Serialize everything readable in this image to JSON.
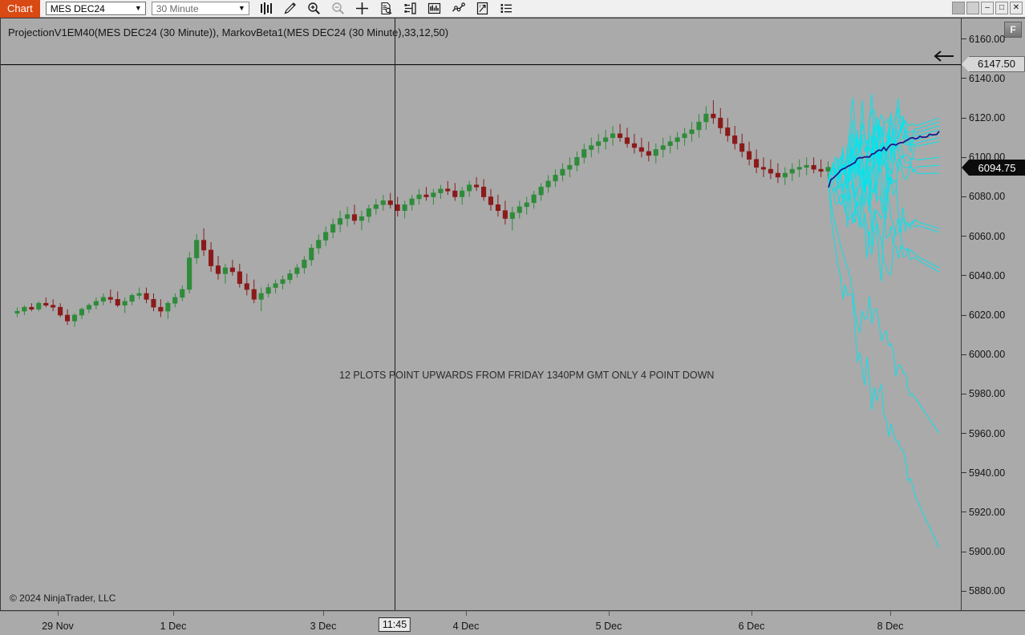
{
  "window": {
    "tab_label": "Chart",
    "controls": {
      "restore_down_label": "",
      "minimize_label": "–",
      "maximize_label": "□",
      "close_label": "✕"
    }
  },
  "toolbar": {
    "instrument": {
      "value": "MES DEC24",
      "arrow": "▼"
    },
    "interval": {
      "value": "30 Minute",
      "arrow": "▼"
    },
    "icons": [
      {
        "name": "bar-chart-type-icon",
        "enabled": true
      },
      {
        "name": "drawing-tools-pencil-icon",
        "enabled": true
      },
      {
        "name": "zoom-in-icon",
        "enabled": true
      },
      {
        "name": "zoom-out-icon",
        "enabled": false
      },
      {
        "name": "crosshair-icon",
        "enabled": true
      },
      {
        "name": "data-box-icon",
        "enabled": true
      },
      {
        "name": "chart-properties-icon",
        "enabled": true
      },
      {
        "name": "indicators-icon",
        "enabled": true
      },
      {
        "name": "strategies-icon",
        "enabled": true
      },
      {
        "name": "export-chart-icon",
        "enabled": true
      },
      {
        "name": "data-series-list-icon",
        "enabled": true
      }
    ]
  },
  "chart": {
    "title": "ProjectionV1EM40(MES DEC24 (30 Minute)), MarkovBeta1(MES DEC24 (30 Minute),33,12,50)",
    "annotation": "12 PLOTS POINT UPWARDS FROM FRIDAY 1340PM GMT ONLY 4 POINT DOWN",
    "copyright": "© 2024 NinjaTrader, LLC",
    "back_arrow_icon": "left-arrow-icon",
    "auto_scale_badge": "F",
    "crosshair_time": "11:45"
  },
  "price_axis": {
    "ticks": [
      "6160.00",
      "6140.00",
      "6120.00",
      "6100.00",
      "6080.00",
      "6060.00",
      "6040.00",
      "6020.00",
      "6000.00",
      "5980.00",
      "5960.00",
      "5940.00",
      "5920.00",
      "5900.00",
      "5880.00"
    ],
    "last_price_marker": "6147.50",
    "current_price_marker": "6094.75"
  },
  "time_axis": {
    "ticks": [
      "29 Nov",
      "1 Dec",
      "3 Dec",
      "4 Dec",
      "5 Dec",
      "6 Dec",
      "8 Dec"
    ]
  },
  "colors": {
    "tab_accent": "#d94913",
    "chart_background": "#aaaaaa",
    "candle_up": "#2e8b3a",
    "candle_down": "#8b1a1a",
    "projection_line": "#00e5ee",
    "average_line": "#1a1a8c",
    "current_price_bg": "#0b0b0b",
    "last_price_bg": "#d7d7d7"
  },
  "chart_data": {
    "type": "line",
    "title": "ProjectionV1EM40(MES DEC24 (30 Minute)), MarkovBeta1(MES DEC24 (30 Minute),33,12,50)",
    "xlabel": "",
    "ylabel": "",
    "ylim": [
      5870,
      6170
    ],
    "grid": false,
    "legend": "none",
    "x_tick_labels": [
      "29 Nov",
      "1 Dec",
      "3 Dec",
      "4 Dec",
      "5 Dec",
      "6 Dec",
      "8 Dec"
    ],
    "y_tick_labels": [
      "6160.00",
      "6140.00",
      "6120.00",
      "6100.00",
      "6080.00",
      "6060.00",
      "6040.00",
      "6020.00",
      "6000.00",
      "5980.00",
      "5960.00",
      "5940.00",
      "5920.00",
      "5900.00",
      "5880.00"
    ],
    "annotations": [
      {
        "text": "12 PLOTS POINT UPWARDS FROM FRIDAY 1340PM GMT ONLY 4 POINT DOWN",
        "x": 0.42,
        "y": 6057
      },
      {
        "text": "6147.50",
        "y": 6147.5,
        "kind": "horizontal-line"
      },
      {
        "text": "6094.75",
        "y": 6094.75,
        "kind": "price-marker"
      }
    ],
    "series": [
      {
        "name": "MES DEC24 price (OHLC candles)",
        "type": "candlestick",
        "ohlc": [
          [
            6021,
            6024,
            6019,
            6022
          ],
          [
            6022,
            6025,
            6020,
            6024
          ],
          [
            6024,
            6026,
            6022,
            6023
          ],
          [
            6023,
            6027,
            6022,
            6026
          ],
          [
            6026,
            6029,
            6024,
            6025
          ],
          [
            6025,
            6028,
            6022,
            6024
          ],
          [
            6024,
            6026,
            6019,
            6020
          ],
          [
            6020,
            6023,
            6015,
            6017
          ],
          [
            6017,
            6021,
            6014,
            6020
          ],
          [
            6020,
            6024,
            6018,
            6023
          ],
          [
            6023,
            6026,
            6021,
            6025
          ],
          [
            6025,
            6029,
            6023,
            6027
          ],
          [
            6027,
            6031,
            6025,
            6029
          ],
          [
            6029,
            6033,
            6026,
            6028
          ],
          [
            6028,
            6032,
            6024,
            6025
          ],
          [
            6025,
            6029,
            6021,
            6027
          ],
          [
            6027,
            6031,
            6025,
            6030
          ],
          [
            6030,
            6034,
            6028,
            6031
          ],
          [
            6031,
            6034,
            6026,
            6028
          ],
          [
            6028,
            6031,
            6022,
            6024
          ],
          [
            6024,
            6028,
            6019,
            6022
          ],
          [
            6022,
            6027,
            6018,
            6026
          ],
          [
            6026,
            6031,
            6024,
            6029
          ],
          [
            6029,
            6035,
            6027,
            6033
          ],
          [
            6033,
            6052,
            6031,
            6049
          ],
          [
            6049,
            6061,
            6046,
            6058
          ],
          [
            6058,
            6064,
            6050,
            6053
          ],
          [
            6053,
            6057,
            6042,
            6045
          ],
          [
            6045,
            6050,
            6038,
            6041
          ],
          [
            6041,
            6046,
            6036,
            6044
          ],
          [
            6044,
            6048,
            6040,
            6042
          ],
          [
            6042,
            6046,
            6034,
            6036
          ],
          [
            6036,
            6041,
            6030,
            6033
          ],
          [
            6033,
            6038,
            6026,
            6028
          ],
          [
            6028,
            6034,
            6022,
            6031
          ],
          [
            6031,
            6036,
            6029,
            6034
          ],
          [
            6034,
            6038,
            6031,
            6036
          ],
          [
            6036,
            6040,
            6033,
            6038
          ],
          [
            6038,
            6043,
            6036,
            6041
          ],
          [
            6041,
            6046,
            6039,
            6044
          ],
          [
            6044,
            6050,
            6041,
            6048
          ],
          [
            6048,
            6056,
            6045,
            6054
          ],
          [
            6054,
            6061,
            6051,
            6058
          ],
          [
            6058,
            6065,
            6055,
            6062
          ],
          [
            6062,
            6069,
            6059,
            6066
          ],
          [
            6066,
            6073,
            6062,
            6069
          ],
          [
            6069,
            6075,
            6065,
            6071
          ],
          [
            6071,
            6076,
            6066,
            6068
          ],
          [
            6068,
            6073,
            6063,
            6070
          ],
          [
            6070,
            6076,
            6067,
            6074
          ],
          [
            6074,
            6079,
            6071,
            6076
          ],
          [
            6076,
            6081,
            6073,
            6078
          ],
          [
            6078,
            6082,
            6074,
            6076
          ],
          [
            6076,
            6080,
            6070,
            6073
          ],
          [
            6073,
            6078,
            6069,
            6076
          ],
          [
            6076,
            6081,
            6073,
            6079
          ],
          [
            6079,
            6084,
            6076,
            6081
          ],
          [
            6081,
            6085,
            6078,
            6080
          ],
          [
            6080,
            6084,
            6076,
            6082
          ],
          [
            6082,
            6086,
            6079,
            6084
          ],
          [
            6084,
            6088,
            6081,
            6083
          ],
          [
            6083,
            6087,
            6078,
            6080
          ],
          [
            6080,
            6085,
            6076,
            6083
          ],
          [
            6083,
            6088,
            6080,
            6086
          ],
          [
            6086,
            6090,
            6083,
            6085
          ],
          [
            6085,
            6089,
            6078,
            6080
          ],
          [
            6080,
            6084,
            6073,
            6076
          ],
          [
            6076,
            6081,
            6070,
            6073
          ],
          [
            6073,
            6078,
            6066,
            6069
          ],
          [
            6069,
            6075,
            6063,
            6072
          ],
          [
            6072,
            6078,
            6069,
            6075
          ],
          [
            6075,
            6080,
            6071,
            6077
          ],
          [
            6077,
            6083,
            6074,
            6081
          ],
          [
            6081,
            6087,
            6078,
            6085
          ],
          [
            6085,
            6091,
            6082,
            6088
          ],
          [
            6088,
            6094,
            6085,
            6091
          ],
          [
            6091,
            6097,
            6088,
            6094
          ],
          [
            6094,
            6100,
            6090,
            6096
          ],
          [
            6096,
            6103,
            6093,
            6100
          ],
          [
            6100,
            6107,
            6097,
            6104
          ],
          [
            6104,
            6110,
            6100,
            6106
          ],
          [
            6106,
            6112,
            6102,
            6108
          ],
          [
            6108,
            6114,
            6104,
            6110
          ],
          [
            6110,
            6116,
            6106,
            6112
          ],
          [
            6112,
            6117,
            6108,
            6110
          ],
          [
            6110,
            6115,
            6105,
            6107
          ],
          [
            6107,
            6112,
            6102,
            6105
          ],
          [
            6105,
            6110,
            6100,
            6103
          ],
          [
            6103,
            6108,
            6098,
            6101
          ],
          [
            6101,
            6107,
            6097,
            6104
          ],
          [
            6104,
            6110,
            6100,
            6106
          ],
          [
            6106,
            6111,
            6102,
            6108
          ],
          [
            6108,
            6113,
            6104,
            6110
          ],
          [
            6110,
            6115,
            6106,
            6112
          ],
          [
            6112,
            6118,
            6108,
            6114
          ],
          [
            6114,
            6122,
            6110,
            6118
          ],
          [
            6118,
            6126,
            6114,
            6122
          ],
          [
            6122,
            6129,
            6117,
            6120
          ],
          [
            6120,
            6125,
            6112,
            6115
          ],
          [
            6115,
            6120,
            6108,
            6111
          ],
          [
            6111,
            6116,
            6104,
            6107
          ],
          [
            6107,
            6112,
            6100,
            6103
          ],
          [
            6103,
            6108,
            6096,
            6099
          ],
          [
            6099,
            6104,
            6092,
            6095
          ],
          [
            6095,
            6100,
            6090,
            6094
          ],
          [
            6094,
            6099,
            6089,
            6092
          ],
          [
            6092,
            6097,
            6087,
            6090
          ],
          [
            6090,
            6095,
            6086,
            6092
          ],
          [
            6092,
            6097,
            6088,
            6094
          ],
          [
            6094,
            6099,
            6090,
            6095
          ],
          [
            6095,
            6100,
            6091,
            6096
          ],
          [
            6096,
            6100,
            6092,
            6094
          ],
          [
            6094,
            6099,
            6090,
            6093
          ],
          [
            6093,
            6098,
            6089,
            6095
          ]
        ]
      },
      {
        "name": "Markov projection paths (cyan, 16 simulated paths)",
        "type": "line-bundle",
        "color": "#00e5ee",
        "path_count": 16,
        "paths_up": 12,
        "paths_down": 4,
        "end_value_range": [
          5900,
          6150
        ]
      },
      {
        "name": "Projection average (dark blue)",
        "type": "line",
        "color": "#1a1a8c",
        "start_value": 6085,
        "end_value": 6113
      }
    ]
  }
}
